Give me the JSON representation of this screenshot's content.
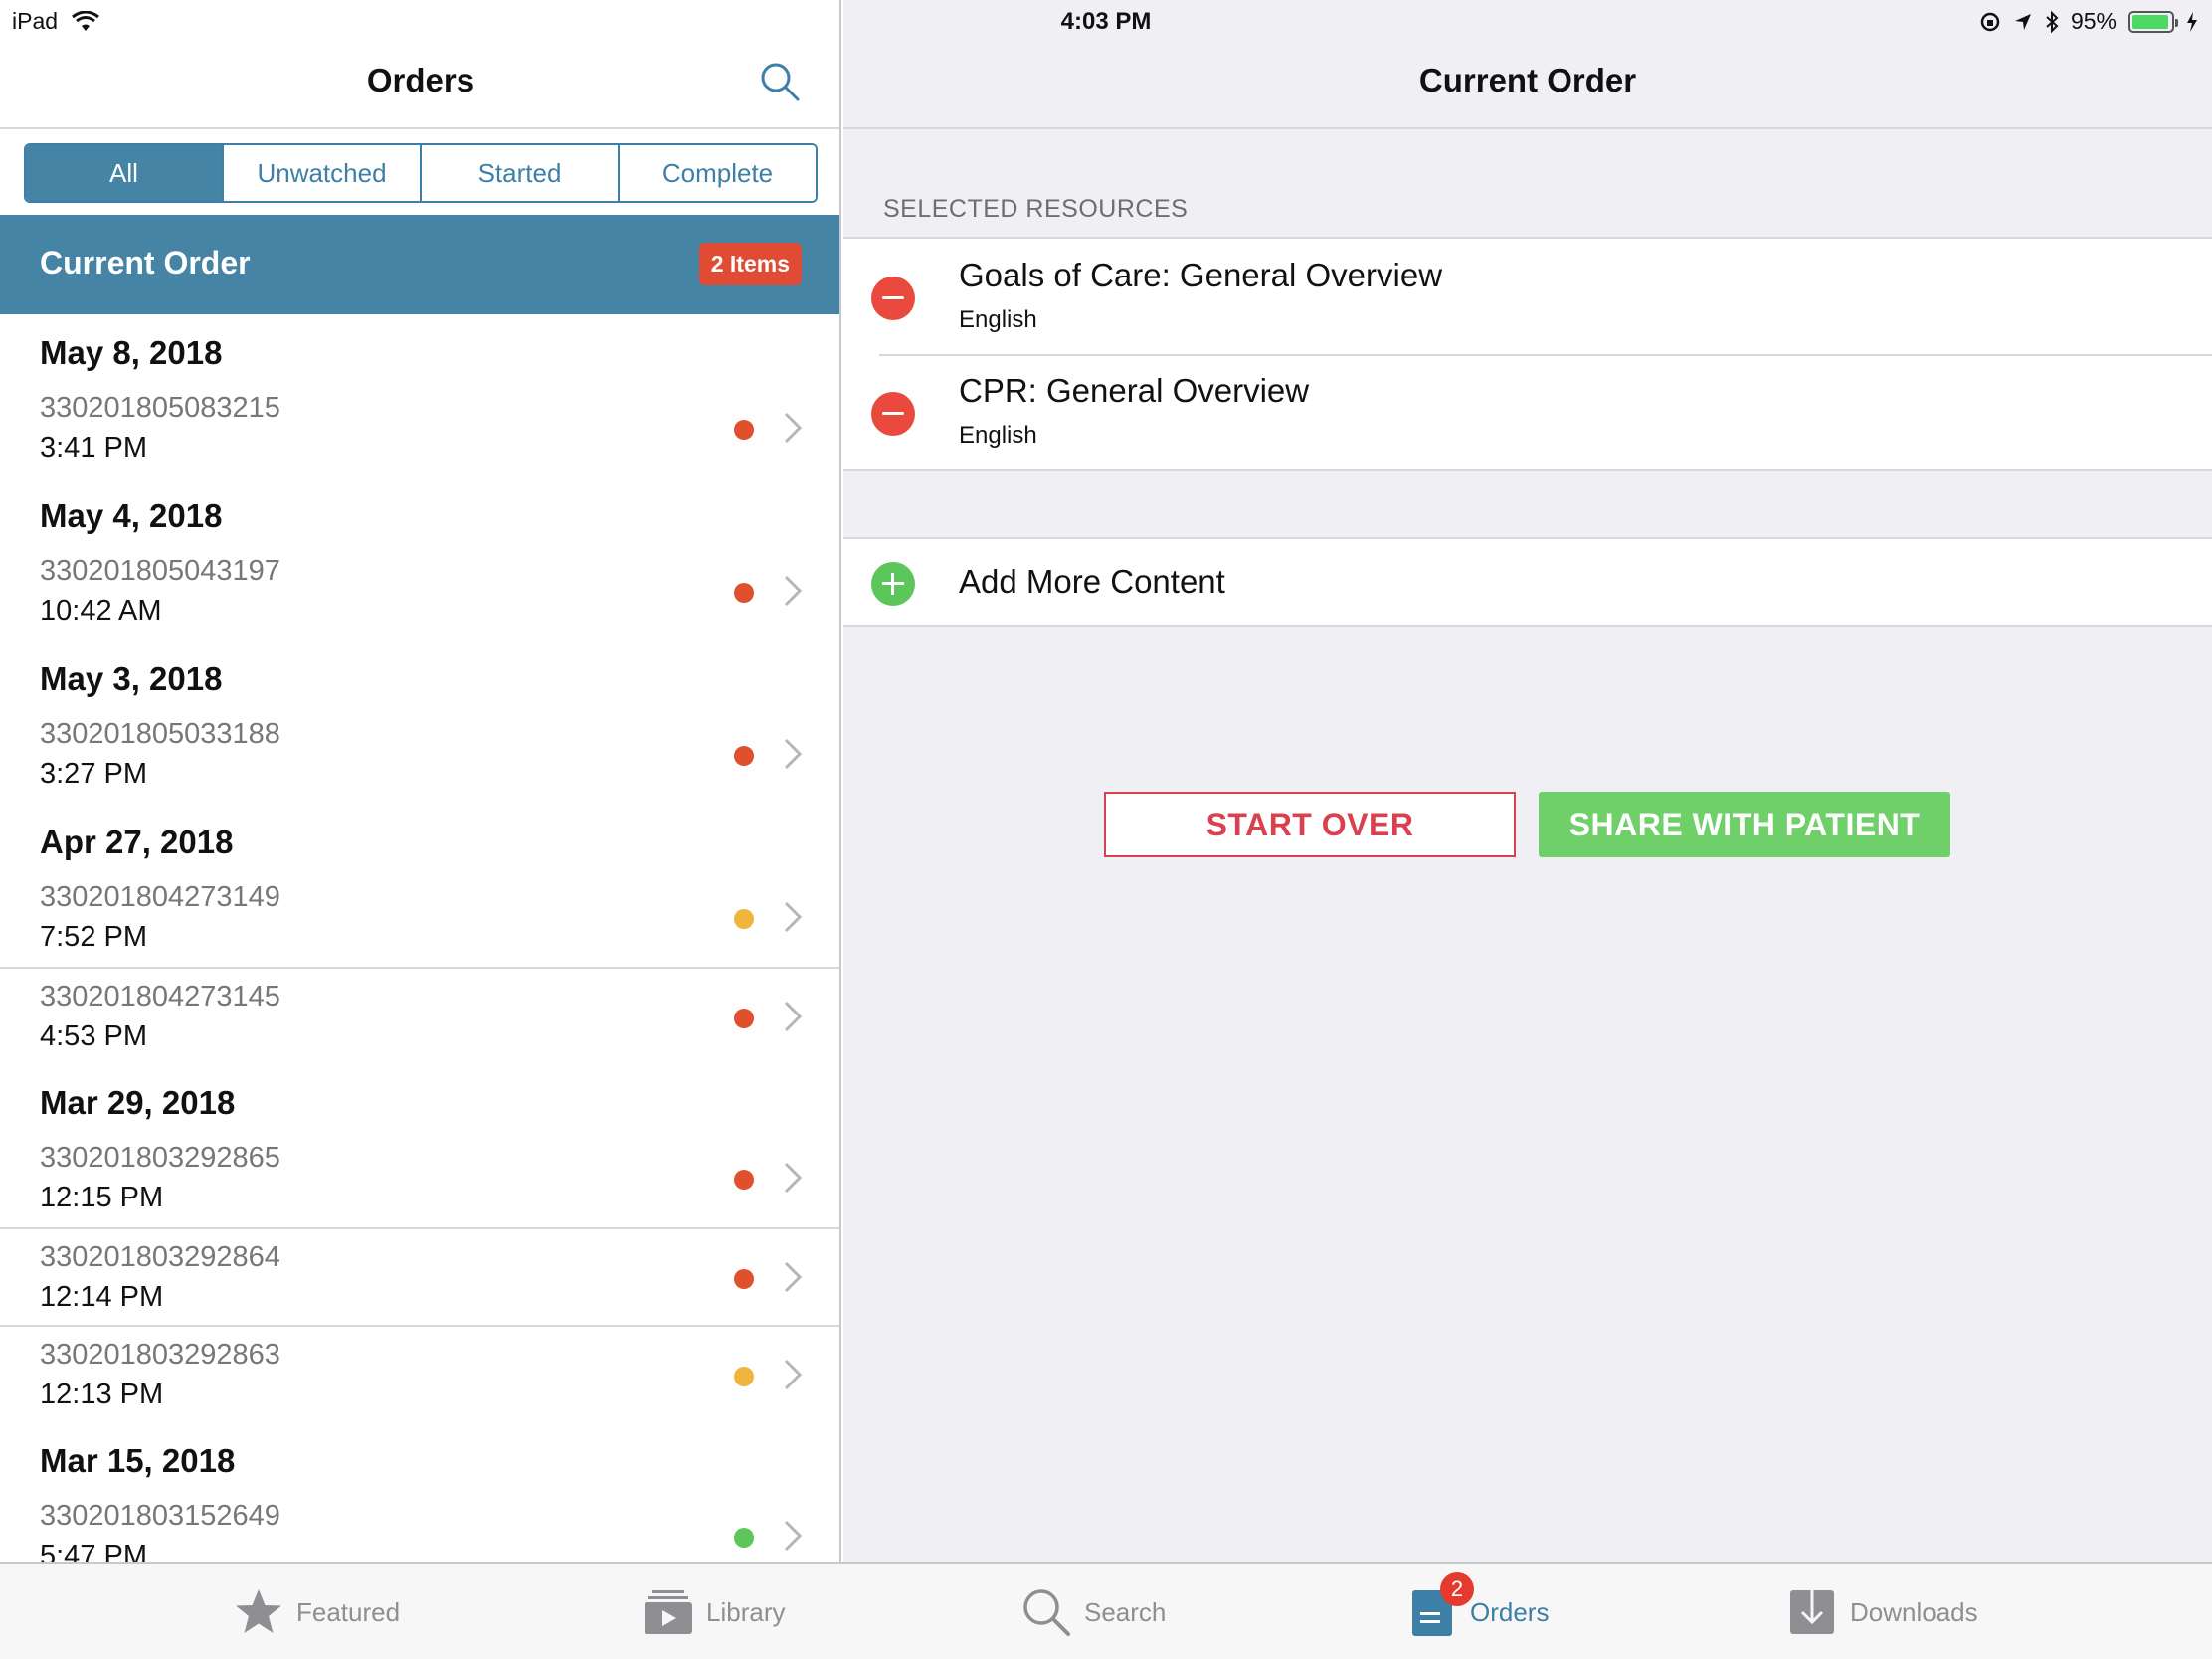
{
  "status_bar": {
    "device": "iPad",
    "time": "4:03 PM",
    "battery_percent": "95%",
    "battery_level": 0.95
  },
  "left_pane": {
    "title": "Orders",
    "segments": [
      "All",
      "Unwatched",
      "Started",
      "Complete"
    ],
    "selected_segment": "All",
    "current_order": {
      "label": "Current Order",
      "badge": "2 Items"
    },
    "groups": [
      {
        "date": "May 8, 2018",
        "orders": [
          {
            "id": "330201805083215",
            "time": "3:41 PM",
            "status_color": "#e0502c"
          }
        ]
      },
      {
        "date": "May 4, 2018",
        "orders": [
          {
            "id": "330201805043197",
            "time": "10:42 AM",
            "status_color": "#e0502c"
          }
        ]
      },
      {
        "date": "May 3, 2018",
        "orders": [
          {
            "id": "330201805033188",
            "time": "3:27 PM",
            "status_color": "#e0502c"
          }
        ]
      },
      {
        "date": "Apr 27, 2018",
        "orders": [
          {
            "id": "330201804273149",
            "time": "7:52 PM",
            "status_color": "#efb53e"
          },
          {
            "id": "330201804273145",
            "time": "4:53 PM",
            "status_color": "#e0502c"
          }
        ]
      },
      {
        "date": "Mar 29, 2018",
        "orders": [
          {
            "id": "330201803292865",
            "time": "12:15 PM",
            "status_color": "#e0502c"
          },
          {
            "id": "330201803292864",
            "time": "12:14 PM",
            "status_color": "#e0502c"
          },
          {
            "id": "330201803292863",
            "time": "12:13 PM",
            "status_color": "#efb53e"
          }
        ]
      },
      {
        "date": "Mar 15, 2018",
        "orders": [
          {
            "id": "330201803152649",
            "time": "5:47 PM",
            "status_color": "#5cc65b"
          }
        ]
      }
    ]
  },
  "right_pane": {
    "title": "Current Order",
    "section_header": "SELECTED RESOURCES",
    "resources": [
      {
        "title": "Goals of Care: General Overview",
        "language": "English"
      },
      {
        "title": "CPR: General Overview",
        "language": "English"
      }
    ],
    "add_more_label": "Add More Content",
    "start_over_label": "START OVER",
    "share_label": "SHARE WITH PATIENT"
  },
  "tab_bar": {
    "items": [
      {
        "label": "Featured",
        "icon": "star-icon"
      },
      {
        "label": "Library",
        "icon": "library-icon"
      },
      {
        "label": "Search",
        "icon": "search-icon"
      },
      {
        "label": "Orders",
        "icon": "orders-icon",
        "badge": "2",
        "active": true
      },
      {
        "label": "Downloads",
        "icon": "downloads-icon"
      }
    ]
  },
  "colors": {
    "accent": "#4584a5",
    "danger": "#ea4a3d",
    "success": "#5cc65b",
    "badge": "#e04b33"
  }
}
